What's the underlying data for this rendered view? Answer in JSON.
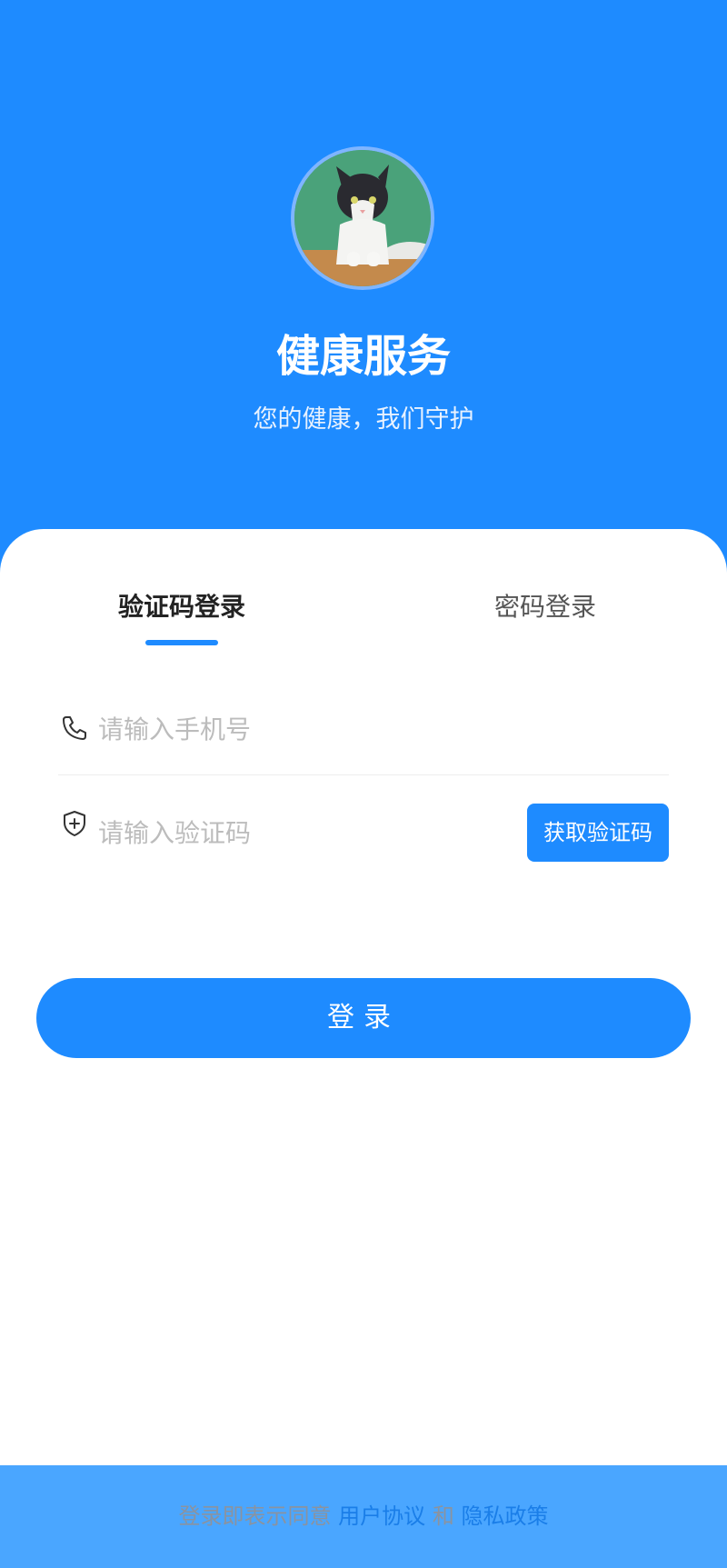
{
  "header": {
    "title": "健康服务",
    "subtitle": "您的健康，我们守护"
  },
  "tabs": [
    {
      "label": "验证码登录",
      "active": true
    },
    {
      "label": "密码登录",
      "active": false
    }
  ],
  "form": {
    "phone": {
      "placeholder": "请输入手机号",
      "value": "",
      "icon": "phone-icon"
    },
    "code": {
      "placeholder": "请输入验证码",
      "value": "",
      "icon": "shield-plus-icon"
    },
    "get_code_label": "获取验证码",
    "login_label": "登录"
  },
  "footer": {
    "prefix": "登录即表示同意",
    "user_agreement": "用户协议",
    "conjunction": "和",
    "privacy_policy": "隐私政策"
  },
  "colors": {
    "primary": "#1e8bff",
    "footer_bg": "#4aa6ff",
    "link": "#1a7ee8"
  }
}
